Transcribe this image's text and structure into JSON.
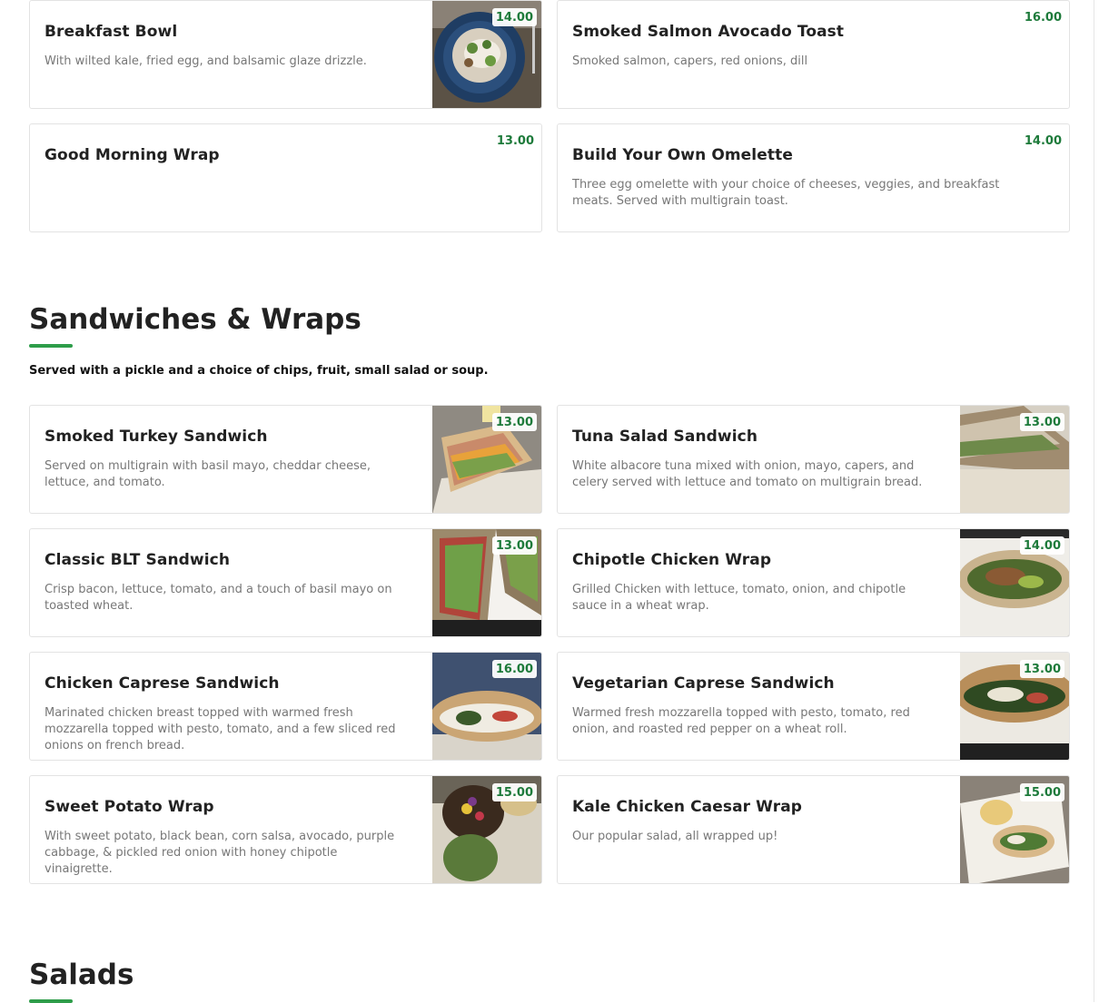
{
  "breakfast": {
    "items": [
      {
        "name": "Breakfast Bowl",
        "desc": "With wilted kale, fried egg, and balsamic glaze drizzle.",
        "price": "14.00"
      },
      {
        "name": "Smoked Salmon Avocado Toast",
        "desc": "Smoked salmon, capers, red onions, dill",
        "price": "16.00"
      },
      {
        "name": "Good Morning Wrap",
        "desc": "",
        "price": "13.00"
      },
      {
        "name": "Build Your Own Omelette",
        "desc": "Three egg omelette with your choice of cheeses, veggies, and breakfast meats. Served with multigrain toast.",
        "price": "14.00"
      }
    ]
  },
  "sandwiches": {
    "title": "Sandwiches & Wraps",
    "note": "Served with a pickle and a choice of chips, fruit, small salad or soup.",
    "items": [
      {
        "name": "Smoked Turkey Sandwich",
        "desc": "Served on multigrain with basil mayo, cheddar cheese, lettuce, and tomato.",
        "price": "13.00"
      },
      {
        "name": "Tuna Salad Sandwich",
        "desc": "White albacore tuna mixed with onion, mayo, capers, and celery served with lettuce and tomato on multigrain bread.",
        "price": "13.00"
      },
      {
        "name": "Classic BLT Sandwich",
        "desc": "Crisp bacon, lettuce, tomato, and a touch of basil mayo on toasted wheat.",
        "price": "13.00"
      },
      {
        "name": "Chipotle Chicken Wrap",
        "desc": "Grilled Chicken with lettuce, tomato, onion, and chipotle sauce in a wheat wrap.",
        "price": "14.00"
      },
      {
        "name": "Chicken Caprese Sandwich",
        "desc": "Marinated chicken breast topped with warmed fresh mozzarella topped with pesto, tomato, and a few sliced red onions on french bread.",
        "price": "16.00"
      },
      {
        "name": "Vegetarian Caprese Sandwich",
        "desc": "Warmed fresh mozzarella topped with pesto, tomato, red onion, and roasted red pepper on a wheat roll.",
        "price": "13.00"
      },
      {
        "name": "Sweet Potato Wrap",
        "desc": "With sweet potato, black bean, corn salsa, avocado, purple cabbage, & pickled red onion with honey chipotle vinaigrette.",
        "price": "15.00"
      },
      {
        "name": "Kale Chicken Caesar Wrap",
        "desc": "Our popular salad, all wrapped up!",
        "price": "15.00"
      }
    ]
  },
  "salads": {
    "title": "Salads"
  },
  "colors": {
    "price": "#1d7a3a",
    "accent_underline": "#2e9d4a",
    "card_border": "#e3e3e3"
  }
}
